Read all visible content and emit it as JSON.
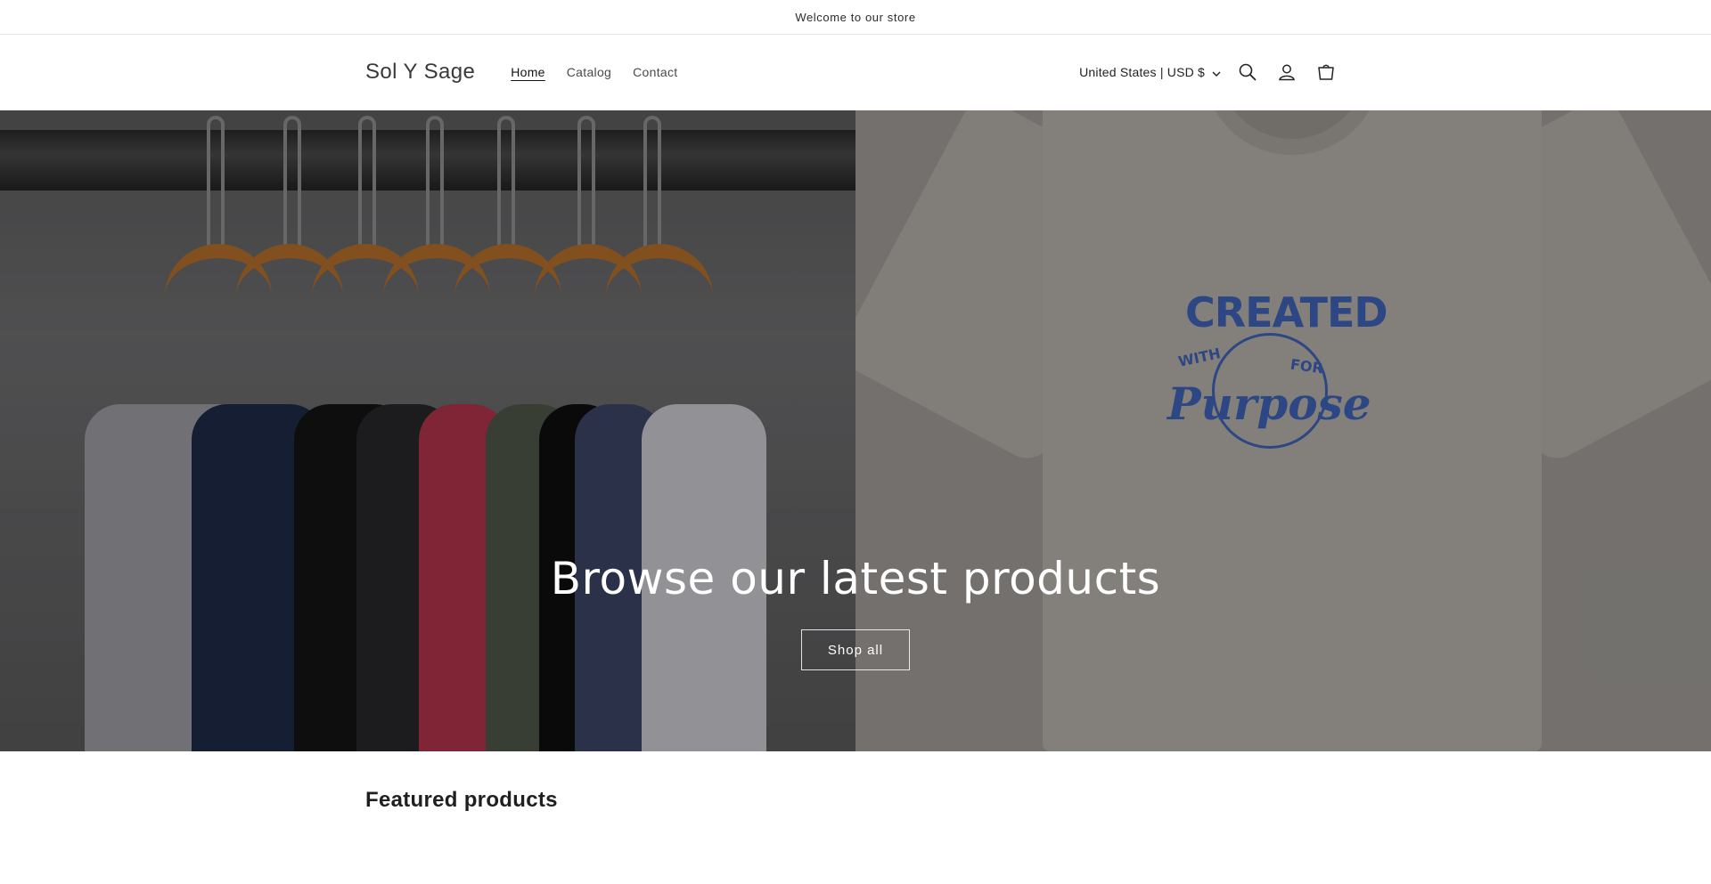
{
  "announcement": {
    "text": "Welcome to our store"
  },
  "header": {
    "logo": "Sol Y Sage",
    "nav": [
      {
        "label": "Home",
        "active": true
      },
      {
        "label": "Catalog",
        "active": false
      },
      {
        "label": "Contact",
        "active": false
      }
    ],
    "localization": "United States | USD $",
    "icons": [
      "search-icon",
      "account-icon",
      "cart-icon",
      "chevron-down-icon"
    ]
  },
  "hero": {
    "title": "Browse our latest products",
    "button_label": "Shop all",
    "tee_graphic": {
      "top": "CREATED",
      "with": "WITH",
      "for": "FOR",
      "bottom": "Purpose"
    }
  },
  "featured": {
    "title": "Featured products"
  },
  "colors": {
    "graphic_blue": "#3f63b8",
    "hanger_wood": "#b4702c"
  }
}
